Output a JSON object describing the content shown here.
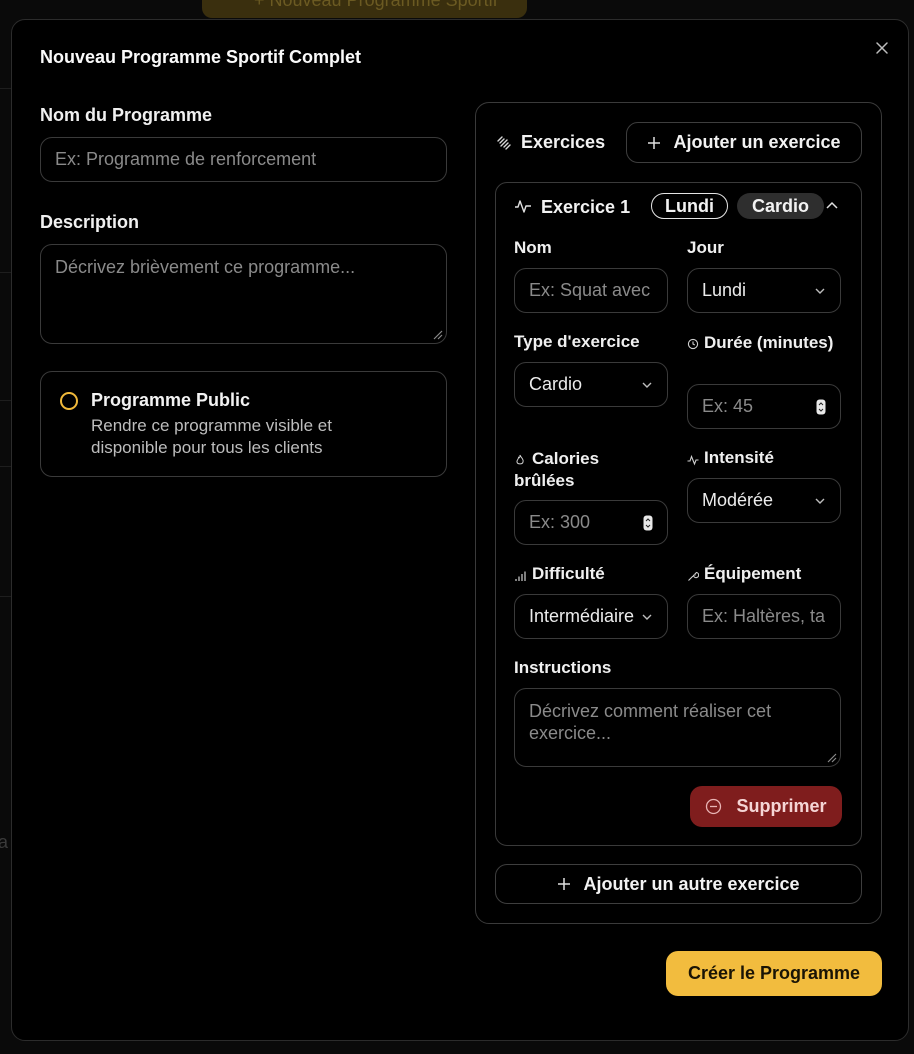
{
  "backdrop": {
    "header_button_label": "+ Nouveau Programme Sportif",
    "side_text": "a"
  },
  "modal": {
    "title": "Nouveau Programme Sportif Complet",
    "close_icon": "close-icon"
  },
  "form": {
    "name_label": "Nom du Programme",
    "name_placeholder": "Ex: Programme de renforcement",
    "description_label": "Description",
    "description_placeholder": "Décrivez brièvement ce programme...",
    "public": {
      "title": "Programme Public",
      "description": "Rendre ce programme visible et disponible pour tous les clients",
      "checked": false
    }
  },
  "exercises": {
    "section_title": "Exercices",
    "section_icon": "dumbbell-icon",
    "add_button_label": "Ajouter un exercice",
    "add_another_label": "Ajouter un autre exercice",
    "items": [
      {
        "title": "Exercice 1",
        "day_badge": "Lundi",
        "type_badge": "Cardio",
        "expanded": true,
        "fields": {
          "name_label": "Nom",
          "name_placeholder": "Ex: Squat avec haltères",
          "day_label": "Jour",
          "day_value": "Lundi",
          "type_label": "Type d'exercice",
          "type_value": "Cardio",
          "duration_label": "Durée (minutes)",
          "duration_placeholder": "Ex: 45",
          "calories_label": "Calories brûlées",
          "calories_placeholder": "Ex: 300",
          "intensity_label": "Intensité",
          "intensity_value": "Modérée",
          "difficulty_label": "Difficulté",
          "difficulty_value": "Intermédiaire",
          "equipment_label": "Équipement",
          "equipment_placeholder": "Ex: Haltères, tapis",
          "instructions_label": "Instructions",
          "instructions_placeholder": "Décrivez comment réaliser cet exercice..."
        },
        "delete_label": "Supprimer"
      }
    ]
  },
  "submit_label": "Créer le Programme",
  "colors": {
    "accent": "#f2bc3e",
    "danger": "#7f1d1d",
    "border": "#3a3a3a",
    "background": "#000000"
  }
}
